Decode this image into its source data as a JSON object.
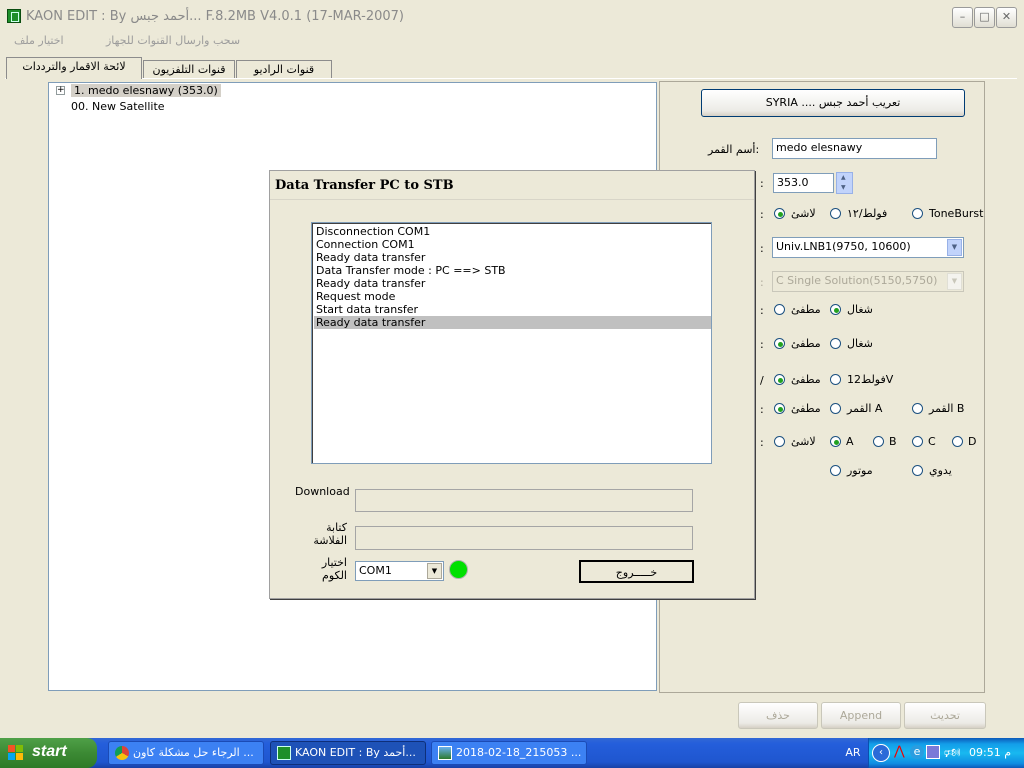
{
  "window": {
    "title": "KAON EDIT : By أحمد جبس...   F.8.2MB V4.0.1 (17-MAR-2007)",
    "minimize": "–",
    "maximize": "□",
    "close": "✕"
  },
  "menu": [
    "اختيار ملف",
    "سحب وارسال القنوات للجهاز"
  ],
  "tabs": [
    "لائحة الاقمار والترددات",
    "قنوات التلفزيون",
    "قنوات الراديو"
  ],
  "tree": {
    "expander": "+",
    "items": [
      "1. medo elesnawy (353.0)",
      "00. New Satellite"
    ]
  },
  "right": {
    "credit_button": "SYRIA .... تعريب أحمد جبس",
    "sat_name_label": "أسم القمر:",
    "sat_name_value": "medo elesnawy",
    "position_value": "353.0",
    "label_fragments": [
      ":",
      ":",
      ":",
      ":",
      ":",
      ":",
      ":",
      "/",
      ":",
      ":"
    ],
    "tone": {
      "opt1": "لاشئ",
      "opt2": "فولط/١٢",
      "opt3": "ToneBurst",
      "selected": 0
    },
    "lnb_value": "Univ.LNB1(9750, 10600)",
    "csolution_value": "C Single Solution(5150,5750)",
    "row_shaghal1": {
      "off": "مطفئ",
      "on": "شغال",
      "selected": 1
    },
    "row_shaghal2": {
      "off": "مطفئ",
      "on": "شغال",
      "selected": 0
    },
    "row_12v": {
      "off": "مطفئ",
      "on": "فولط12V",
      "selected": 0
    },
    "row_sat": {
      "off": "مطفئ",
      "a": "القمر A",
      "b": "القمر B",
      "selected": 0
    },
    "row_diseqc": {
      "none": "لاشئ",
      "a": "A",
      "b": "B",
      "c": "C",
      "d": "D",
      "selected": 1
    },
    "row_motor": {
      "motor": "موتور",
      "manual": "يدوي"
    },
    "delete_button": "حذف",
    "append_button": "Append",
    "update_button": "تحديث"
  },
  "dialog": {
    "title": "Data Transfer PC to STB",
    "log": [
      "Disconnection COM1",
      "Connection COM1",
      "Ready data transfer",
      "Data Transfer mode : PC ==> STB",
      "Ready data transfer",
      "Request mode",
      "Start data transfer",
      "Ready data transfer"
    ],
    "selected_index": 7,
    "download_label": "Download",
    "flash_label_1": "كتابة",
    "flash_label_2": "الفلاشة",
    "com_label_1": "اختيار",
    "com_label_2": "الكوم",
    "com_value": "COM1",
    "exit_button": "خـــــروج",
    "status_color": "#00e000"
  },
  "taskbar": {
    "start": "start",
    "items": [
      "الرجاء حل مشكلة كاون ...",
      "KAON EDIT : By أحمد...",
      "2018-02-18_215053 ..."
    ],
    "active_index": 1,
    "lang": "AR",
    "clock": "09:51 م"
  }
}
